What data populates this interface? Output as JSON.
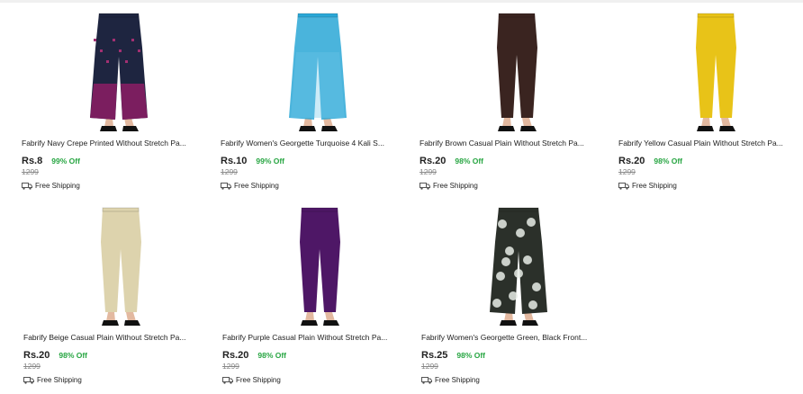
{
  "colors": {
    "discount": "#26a541",
    "mrp": "#878787"
  },
  "products": [
    {
      "title": "Fabrify Navy Crepe Printed Without Stretch Pa...",
      "price": "Rs.8",
      "discount": "99% Off",
      "mrp": "1299",
      "shipping": "Free Shipping",
      "color": "#1e2540",
      "pattern": "navy-print"
    },
    {
      "title": "Fabrify Women's Georgette Turquoise 4 Kali S...",
      "price": "Rs.10",
      "discount": "99% Off",
      "mrp": "1299",
      "shipping": "Free Shipping",
      "color": "#2aa7d6",
      "pattern": "sheer"
    },
    {
      "title": "Fabrify Brown Casual Plain Without Stretch Pa...",
      "price": "Rs.20",
      "discount": "98% Off",
      "mrp": "1299",
      "shipping": "Free Shipping",
      "color": "#3a2420",
      "pattern": "plain"
    },
    {
      "title": "Fabrify Yellow Casual Plain Without Stretch Pa...",
      "price": "Rs.20",
      "discount": "98% Off",
      "mrp": "1299",
      "shipping": "Free Shipping",
      "color": "#e8c318",
      "pattern": "plain"
    },
    {
      "title": "Fabrify Beige Casual Plain Without Stretch Pa...",
      "price": "Rs.20",
      "discount": "98% Off",
      "mrp": "1299",
      "shipping": "Free Shipping",
      "color": "#ddd3ad",
      "pattern": "plain"
    },
    {
      "title": "Fabrify Purple Casual Plain Without Stretch Pa...",
      "price": "Rs.20",
      "discount": "98% Off",
      "mrp": "1299",
      "shipping": "Free Shipping",
      "color": "#4e1766",
      "pattern": "plain"
    },
    {
      "title": "Fabrify Women's Georgette Green, Black Front...",
      "price": "Rs.25",
      "discount": "98% Off",
      "mrp": "1299",
      "shipping": "Free Shipping",
      "color": "#2b302a",
      "pattern": "floral"
    }
  ]
}
